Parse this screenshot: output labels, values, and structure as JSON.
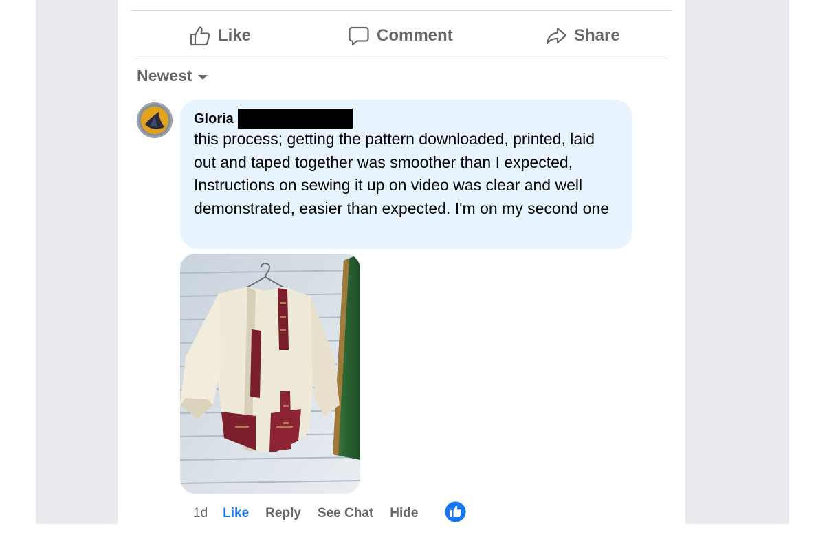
{
  "actions": {
    "like_label": "Like",
    "comment_label": "Comment",
    "share_label": "Share"
  },
  "sort": {
    "label": "Newest"
  },
  "comment": {
    "author": "Gloria",
    "author_name_redacted": true,
    "text": "this process; getting the pattern downloaded, printed, laid out and taped together was smoother than I expected, Instructions on sewing it up on video was clear and well demonstrated, easier than expected. I'm on my second one",
    "photo_icon": "kimono-jacket-photo",
    "timestamp": "1d",
    "like_label": "Like",
    "reply_label": "Reply",
    "see_chat_label": "See Chat",
    "hide_label": "Hide",
    "reaction_icon": "thumbs-up-icon"
  },
  "colors": {
    "bubble": "#e7f3ff",
    "link_blue": "#1877f2",
    "muted": "#65676b",
    "page_bg": "#e9ebee"
  }
}
